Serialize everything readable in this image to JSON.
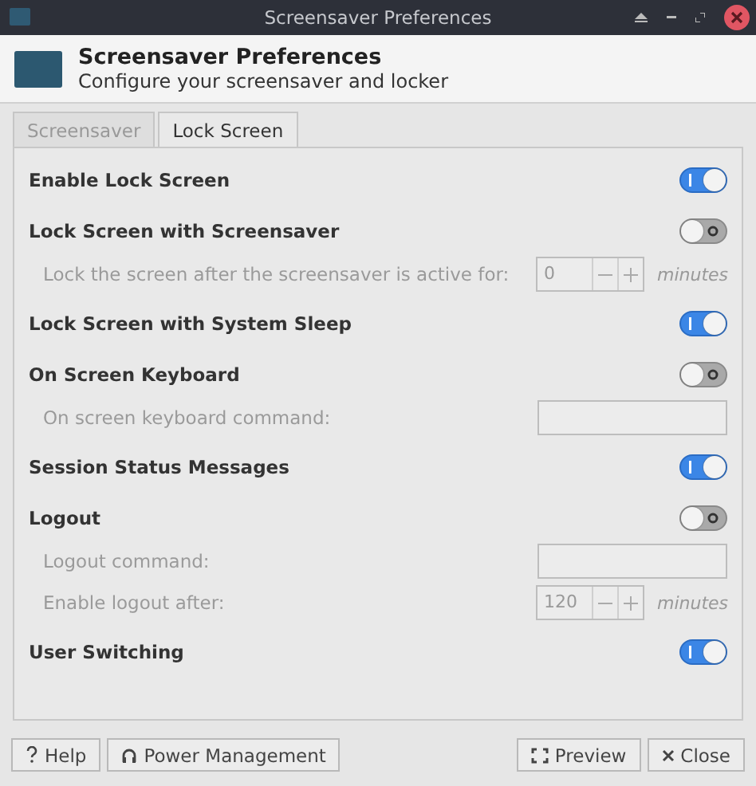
{
  "window": {
    "title": "Screensaver Preferences"
  },
  "header": {
    "title": "Screensaver Preferences",
    "subtitle": "Configure your screensaver and locker"
  },
  "tabs": [
    {
      "label": "Screensaver",
      "selected": false
    },
    {
      "label": "Lock Screen",
      "selected": true
    }
  ],
  "settings": [
    {
      "kind": "switch",
      "label": "Enable Lock Screen",
      "on": true
    },
    {
      "kind": "switch",
      "label": "Lock Screen with Screensaver",
      "on": false
    },
    {
      "kind": "spin",
      "label": "Lock the screen after the screensaver is active for:",
      "value": "0",
      "unit": "minutes",
      "disabled": true
    },
    {
      "kind": "switch",
      "label": "Lock Screen with System Sleep",
      "on": true
    },
    {
      "kind": "switch",
      "label": "On Screen Keyboard",
      "on": false
    },
    {
      "kind": "entry",
      "label": "On screen keyboard command:",
      "disabled": true
    },
    {
      "kind": "switch",
      "label": "Session Status Messages",
      "on": true
    },
    {
      "kind": "switch",
      "label": "Logout",
      "on": false
    },
    {
      "kind": "entry",
      "label": "Logout command:",
      "disabled": true
    },
    {
      "kind": "spin",
      "label": "Enable logout after:",
      "value": "120",
      "unit": "minutes",
      "disabled": true
    },
    {
      "kind": "switch",
      "label": "User Switching",
      "on": true
    }
  ],
  "buttons_left": [
    {
      "label": "Help"
    },
    {
      "label": "Power Management"
    }
  ],
  "buttons_right": [
    {
      "label": "Preview"
    },
    {
      "label": "Close"
    }
  ]
}
